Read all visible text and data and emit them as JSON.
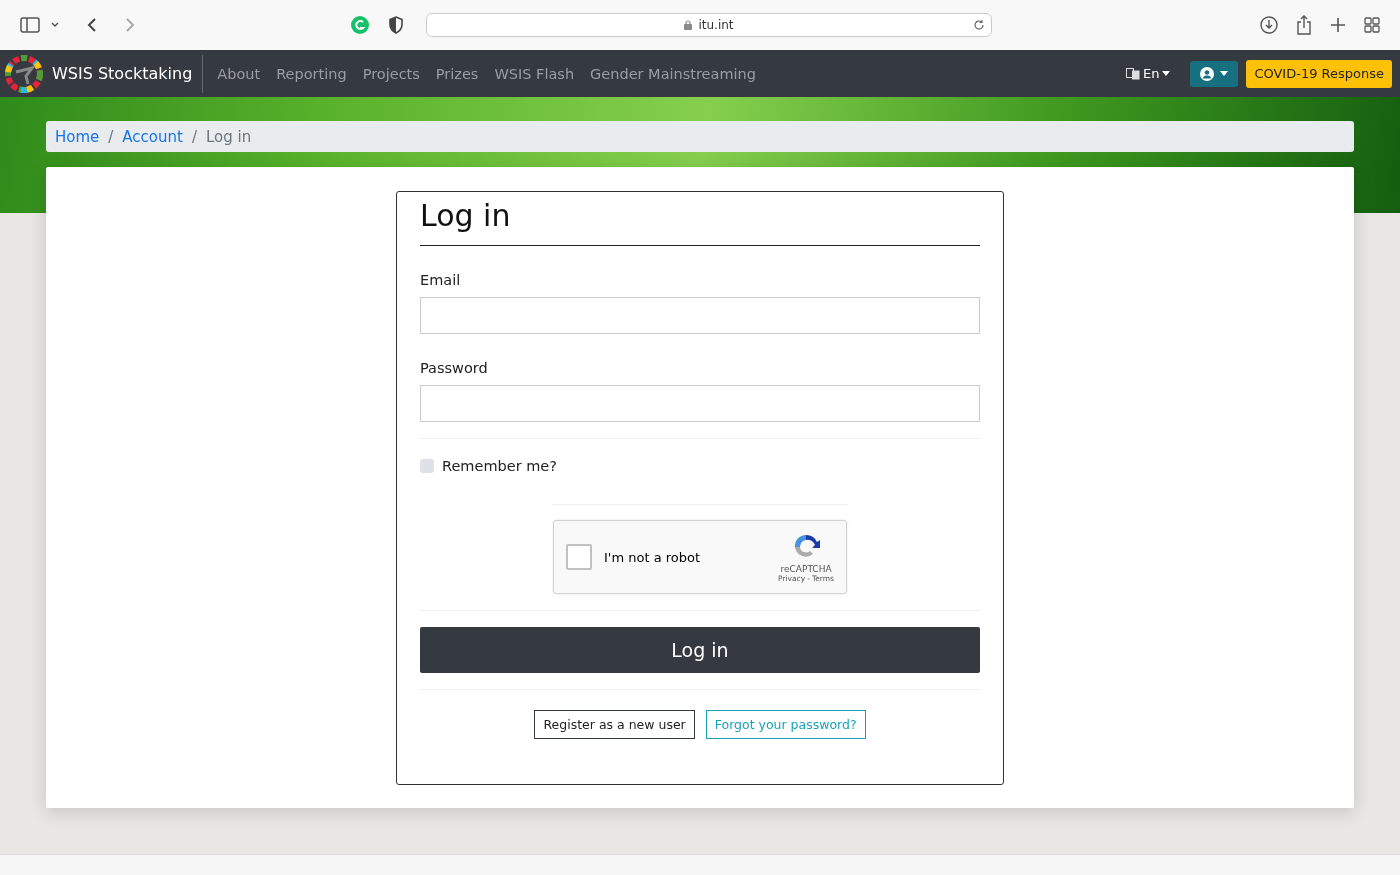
{
  "browser": {
    "url": "itu.int"
  },
  "navbar": {
    "brand": "WSIS Stocktaking",
    "links": [
      "About",
      "Reporting",
      "Projects",
      "Prizes",
      "WSIS Flash",
      "Gender Mainstreaming"
    ],
    "language": "En",
    "covid_button": "COVID-19 Response"
  },
  "breadcrumb": [
    {
      "label": "Home",
      "link": true
    },
    {
      "separator": "/",
      "label": "Account",
      "link": true
    },
    {
      "separator": "/",
      "label": "Log in",
      "link": false
    }
  ],
  "form": {
    "title": "Log in",
    "fields": [
      {
        "label": "Email"
      },
      {
        "label": "Password"
      }
    ],
    "remember": {
      "label": "Remember me?",
      "checked": false
    },
    "captcha": {
      "label": "I'm not a robot",
      "checked": false,
      "brand": "reCAPTCHA",
      "privacy": "Privacy",
      "terms": "Terms",
      "separator": "-"
    },
    "submit": "Log in",
    "links": [
      {
        "label": "Register as a new user",
        "kind": "dark"
      },
      {
        "label": "Forgot your password?",
        "kind": "info"
      }
    ]
  }
}
